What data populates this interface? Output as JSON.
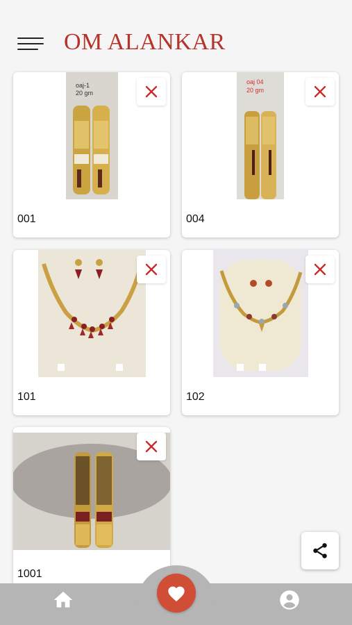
{
  "app": {
    "title": "OM ALANKAR",
    "accent_color": "#b5332a",
    "fab_color": "#cf4e35"
  },
  "favorites": [
    {
      "label": "001",
      "photo_tag_line1": "oaj-1",
      "photo_tag_line2": "20 gm"
    },
    {
      "label": "004",
      "photo_tag_line1": "oaj 04",
      "photo_tag_line2": "20 gm"
    },
    {
      "label": "101"
    },
    {
      "label": "102"
    },
    {
      "label": "1001"
    }
  ],
  "icons": {
    "menu": "hamburger-menu-icon",
    "remove": "close-icon",
    "share": "share-icon",
    "home": "home-icon",
    "favorite": "heart-icon",
    "profile": "account-circle-icon"
  }
}
